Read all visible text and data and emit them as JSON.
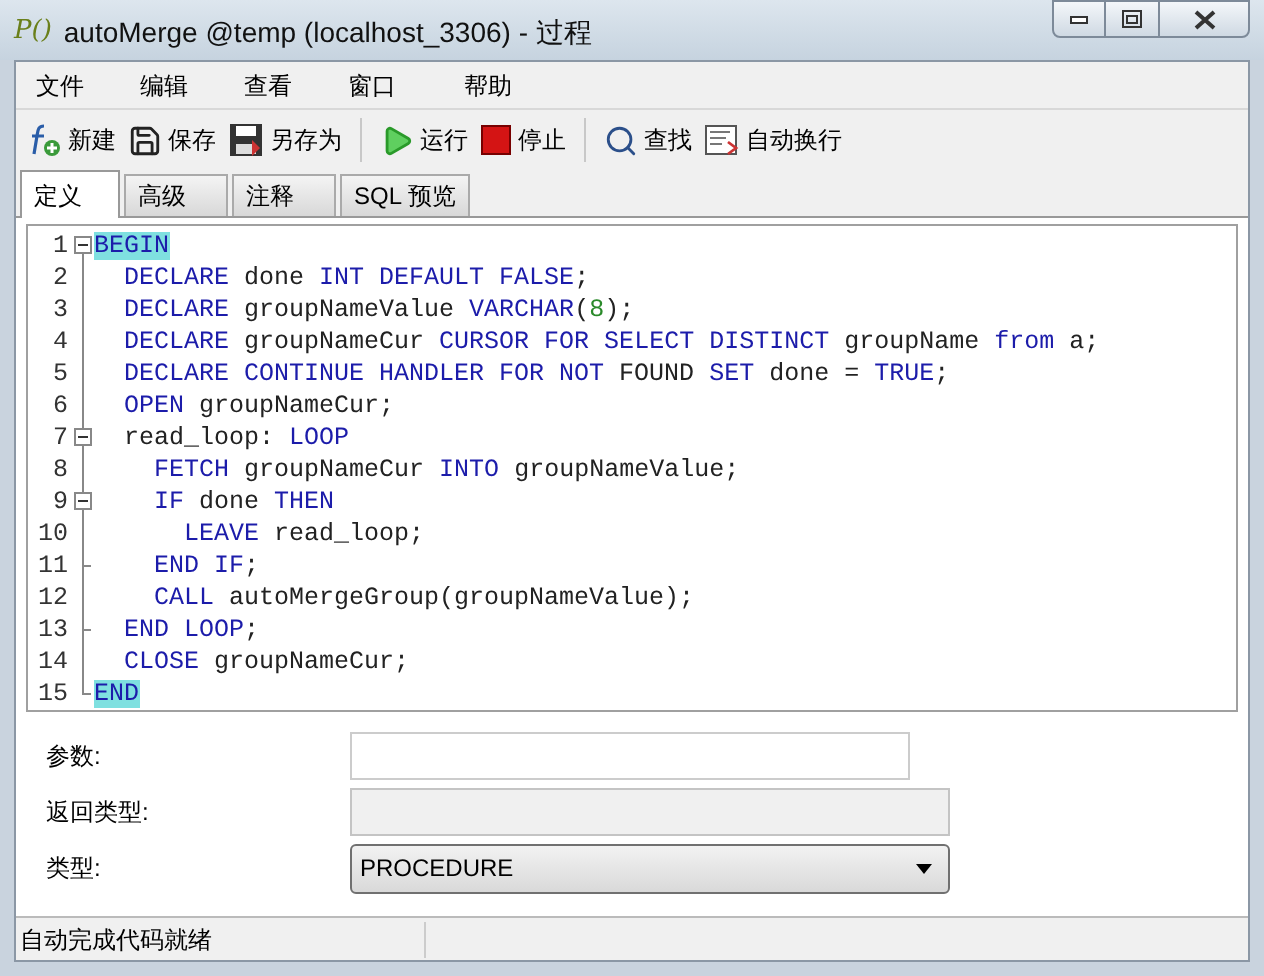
{
  "window": {
    "title": "autoMerge @temp (localhost_3306) - 过程",
    "icon_text": "P()"
  },
  "menu": [
    "文件",
    "编辑",
    "查看",
    "窗口",
    "帮助"
  ],
  "toolbar": [
    {
      "kind": "new",
      "label": "新建"
    },
    {
      "kind": "save",
      "label": "保存"
    },
    {
      "kind": "saveas",
      "label": "另存为"
    },
    {
      "kind": "separator"
    },
    {
      "kind": "run",
      "label": "运行"
    },
    {
      "kind": "stop",
      "label": "停止"
    },
    {
      "kind": "separator"
    },
    {
      "kind": "find",
      "label": "查找"
    },
    {
      "kind": "wrap",
      "label": "自动换行"
    }
  ],
  "tabs": [
    {
      "label": "定义",
      "selected": true
    },
    {
      "label": "高级",
      "selected": false
    },
    {
      "label": "注释",
      "selected": false
    },
    {
      "label": "SQL 预览",
      "selected": false
    }
  ],
  "code": [
    {
      "number": "1",
      "fold_start": true,
      "fold_end": false,
      "tokens": [
        {
          "kind": "match",
          "text": "BEGIN"
        }
      ]
    },
    {
      "number": "2",
      "fold_start": false,
      "fold_end": false,
      "tokens": [
        {
          "kind": "keyword",
          "text": "  DECLARE"
        },
        {
          "kind": "plain",
          "text": " done "
        },
        {
          "kind": "keyword",
          "text": "INT DEFAULT FALSE"
        },
        {
          "kind": "plain",
          "text": ";"
        }
      ]
    },
    {
      "number": "3",
      "fold_start": false,
      "fold_end": false,
      "tokens": [
        {
          "kind": "keyword",
          "text": "  DECLARE"
        },
        {
          "kind": "plain",
          "text": " groupNameValue "
        },
        {
          "kind": "keyword",
          "text": "VARCHAR"
        },
        {
          "kind": "plain",
          "text": "("
        },
        {
          "kind": "number",
          "text": "8"
        },
        {
          "kind": "plain",
          "text": ");"
        }
      ]
    },
    {
      "number": "4",
      "fold_start": false,
      "fold_end": false,
      "tokens": [
        {
          "kind": "keyword",
          "text": "  DECLARE"
        },
        {
          "kind": "plain",
          "text": " groupNameCur "
        },
        {
          "kind": "keyword",
          "text": "CURSOR FOR SELECT DISTINCT"
        },
        {
          "kind": "plain",
          "text": " groupName "
        },
        {
          "kind": "keyword",
          "text": "from"
        },
        {
          "kind": "plain",
          "text": " a;"
        }
      ]
    },
    {
      "number": "5",
      "fold_start": false,
      "fold_end": false,
      "tokens": [
        {
          "kind": "keyword",
          "text": "  DECLARE CONTINUE HANDLER FOR NOT"
        },
        {
          "kind": "plain",
          "text": " FOUND "
        },
        {
          "kind": "keyword",
          "text": "SET"
        },
        {
          "kind": "plain",
          "text": " done = "
        },
        {
          "kind": "keyword",
          "text": "TRUE"
        },
        {
          "kind": "plain",
          "text": ";"
        }
      ]
    },
    {
      "number": "6",
      "fold_start": false,
      "fold_end": false,
      "tokens": [
        {
          "kind": "keyword",
          "text": "  OPEN"
        },
        {
          "kind": "plain",
          "text": " groupNameCur;"
        }
      ]
    },
    {
      "number": "7",
      "fold_start": true,
      "fold_end": false,
      "tokens": [
        {
          "kind": "plain",
          "text": "  read_loop: "
        },
        {
          "kind": "keyword",
          "text": "LOOP"
        }
      ]
    },
    {
      "number": "8",
      "fold_start": false,
      "fold_end": false,
      "tokens": [
        {
          "kind": "keyword",
          "text": "    FETCH"
        },
        {
          "kind": "plain",
          "text": " groupNameCur "
        },
        {
          "kind": "keyword",
          "text": "INTO"
        },
        {
          "kind": "plain",
          "text": " groupNameValue;"
        }
      ]
    },
    {
      "number": "9",
      "fold_start": true,
      "fold_end": false,
      "tokens": [
        {
          "kind": "keyword",
          "text": "    IF"
        },
        {
          "kind": "plain",
          "text": " done "
        },
        {
          "kind": "keyword",
          "text": "THEN"
        }
      ]
    },
    {
      "number": "10",
      "fold_start": false,
      "fold_end": false,
      "tokens": [
        {
          "kind": "keyword",
          "text": "      LEAVE"
        },
        {
          "kind": "plain",
          "text": " read_loop;"
        }
      ]
    },
    {
      "number": "11",
      "fold_start": false,
      "fold_end": true,
      "tokens": [
        {
          "kind": "keyword",
          "text": "    END IF"
        },
        {
          "kind": "plain",
          "text": ";"
        }
      ]
    },
    {
      "number": "12",
      "fold_start": false,
      "fold_end": false,
      "tokens": [
        {
          "kind": "keyword",
          "text": "    CALL"
        },
        {
          "kind": "plain",
          "text": " autoMergeGroup(groupNameValue);"
        }
      ]
    },
    {
      "number": "13",
      "fold_start": false,
      "fold_end": true,
      "tokens": [
        {
          "kind": "keyword",
          "text": "  END LOOP"
        },
        {
          "kind": "plain",
          "text": ";"
        }
      ]
    },
    {
      "number": "14",
      "fold_start": false,
      "fold_end": false,
      "tokens": [
        {
          "kind": "keyword",
          "text": "  CLOSE"
        },
        {
          "kind": "plain",
          "text": " groupNameCur;"
        }
      ]
    },
    {
      "number": "15",
      "fold_start": false,
      "fold_end": true,
      "tokens": [
        {
          "kind": "match",
          "text": "END"
        }
      ]
    }
  ],
  "form": [
    {
      "kind": "input",
      "label": "参数:"
    },
    {
      "kind": "readonly",
      "label": "返回类型:"
    },
    {
      "kind": "select",
      "label": "类型:",
      "value": "PROCEDURE"
    }
  ],
  "status_bar": "自动完成代码就绪"
}
